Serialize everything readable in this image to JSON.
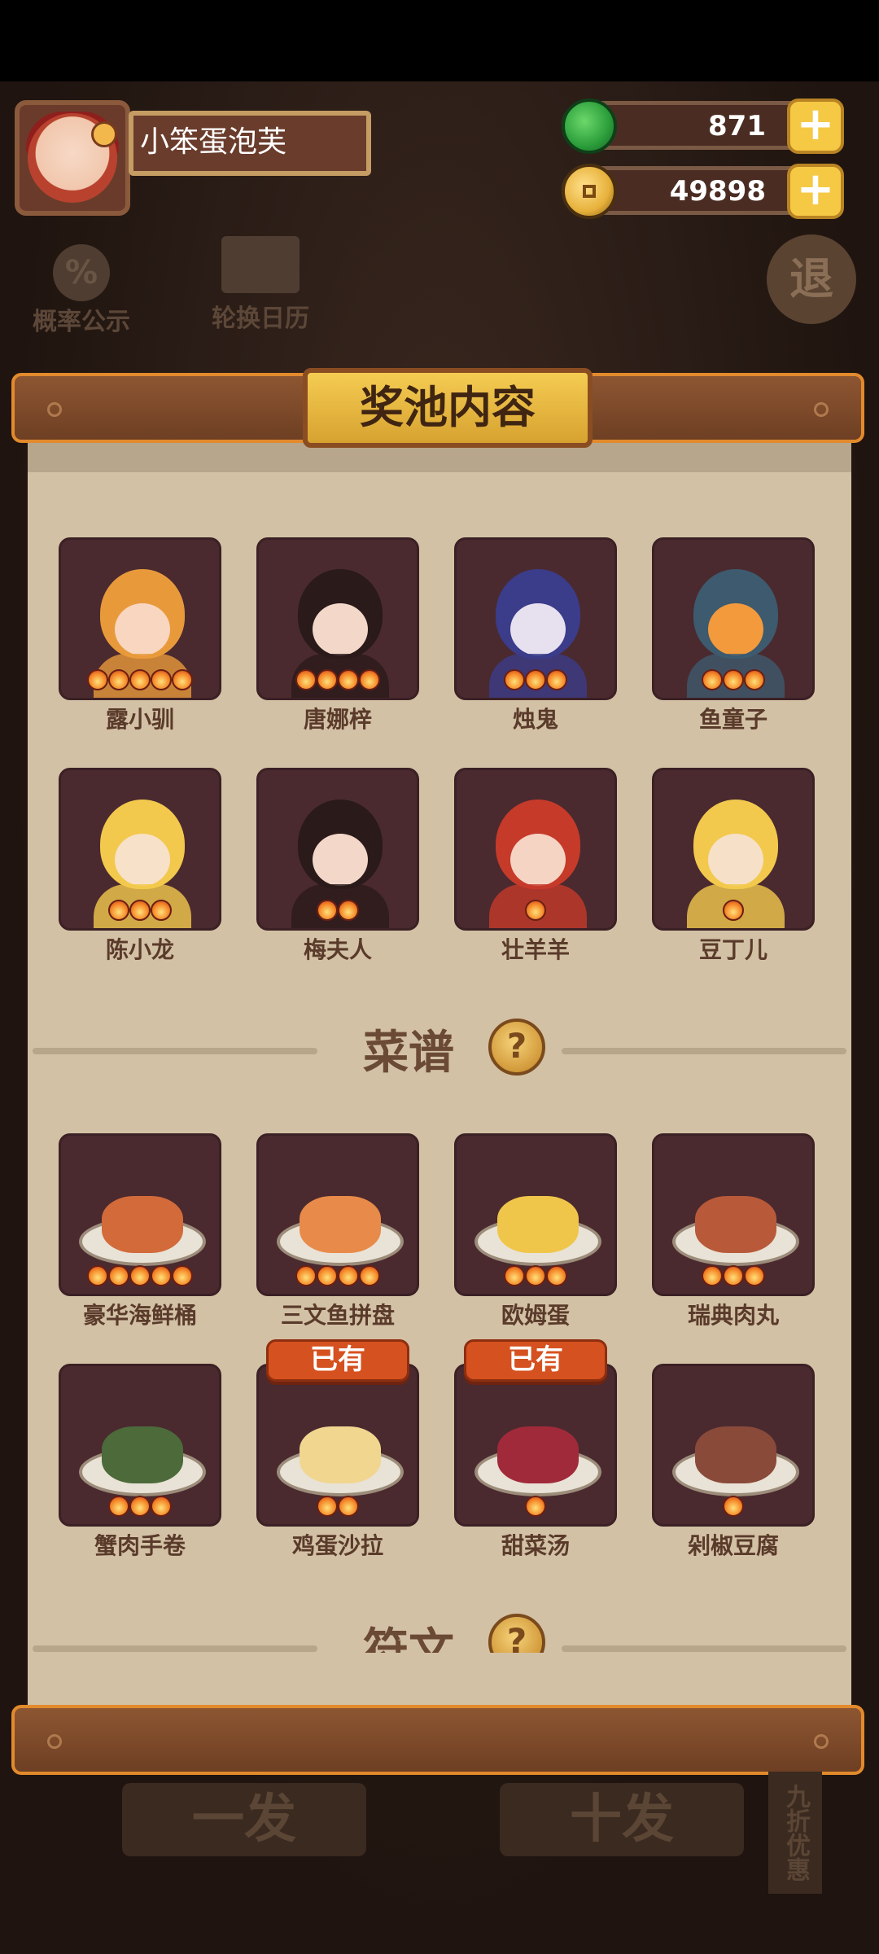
{
  "player": {
    "name": "小笨蛋泡芙"
  },
  "currency": {
    "jade": "871",
    "coins": "49898",
    "plus": "+"
  },
  "background": {
    "probability_label": "概率公示",
    "probability_icon": "%",
    "calendar_label": "轮换日历",
    "exit_label": "退",
    "single_draw": "一发",
    "ten_draw": "十发",
    "discount": "九折优惠"
  },
  "panel": {
    "title": "奖池内容",
    "owned_badge": "已有",
    "characters": [
      {
        "name": "露小驯",
        "stars": 5
      },
      {
        "name": "唐娜梓",
        "stars": 4
      },
      {
        "name": "烛鬼",
        "stars": 3
      },
      {
        "name": "鱼童子",
        "stars": 3
      },
      {
        "name": "陈小龙",
        "stars": 3
      },
      {
        "name": "梅夫人",
        "stars": 2
      },
      {
        "name": "壮羊羊",
        "stars": 1
      },
      {
        "name": "豆丁儿",
        "stars": 1
      }
    ],
    "recipes_section": "菜谱",
    "recipes": [
      {
        "name": "豪华海鲜桶",
        "stars": 5,
        "owned": false
      },
      {
        "name": "三文鱼拼盘",
        "stars": 4,
        "owned": false
      },
      {
        "name": "欧姆蛋",
        "stars": 3,
        "owned": false
      },
      {
        "name": "瑞典肉丸",
        "stars": 3,
        "owned": false
      },
      {
        "name": "蟹肉手卷",
        "stars": 3,
        "owned": false
      },
      {
        "name": "鸡蛋沙拉",
        "stars": 2,
        "owned": true
      },
      {
        "name": "甜菜汤",
        "stars": 1,
        "owned": true
      },
      {
        "name": "剁椒豆腐",
        "stars": 1,
        "owned": false
      }
    ],
    "runes_section": "符文",
    "help_icon": "?"
  },
  "colors": {
    "panel_bg": "#d3c1a5",
    "card_bg": "#4a2a2f",
    "title_gold": "#f5cc52",
    "badge_red": "#d5511f"
  }
}
